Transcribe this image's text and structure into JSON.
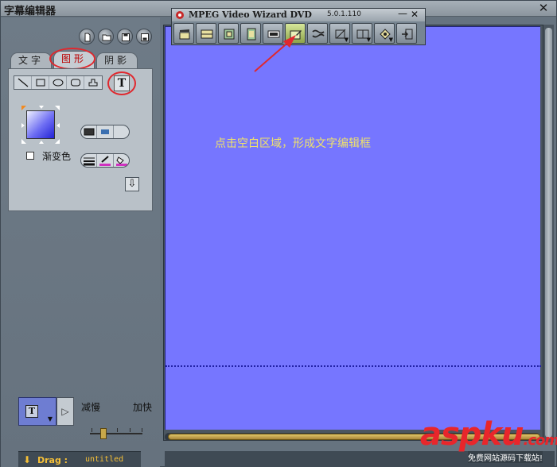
{
  "main_window": {
    "title": "字幕编辑器",
    "close_glyph": "✕"
  },
  "tabs": [
    {
      "label": "文字"
    },
    {
      "label": "图形"
    },
    {
      "label": "阴影"
    }
  ],
  "shape_panel": {
    "text_tool_glyph": "T",
    "gradient_label": "渐变色",
    "down_glyph": "⇩"
  },
  "playback": {
    "slow_label": "减慢",
    "fast_label": "加快",
    "mode_glyph": "T",
    "play_glyph": "▷"
  },
  "status": {
    "arrow_glyph": "⬇",
    "action": "Drag :",
    "document": "untitled"
  },
  "canvas": {
    "hint": "点击空白区域，形成文字编辑框"
  },
  "wizard": {
    "title": "MPEG Video Wizard DVD",
    "version": "5.0.1.110",
    "min_glyph": "—",
    "close_glyph": "✕"
  },
  "watermark": {
    "text": "aspku",
    "domain": ".com",
    "subtitle": "免费网站源码下载站!"
  },
  "colors": {
    "canvas": "#7676ff",
    "annotation": "#e0282e",
    "hint_text": "#f0e36a",
    "status_text": "#f6c037"
  }
}
